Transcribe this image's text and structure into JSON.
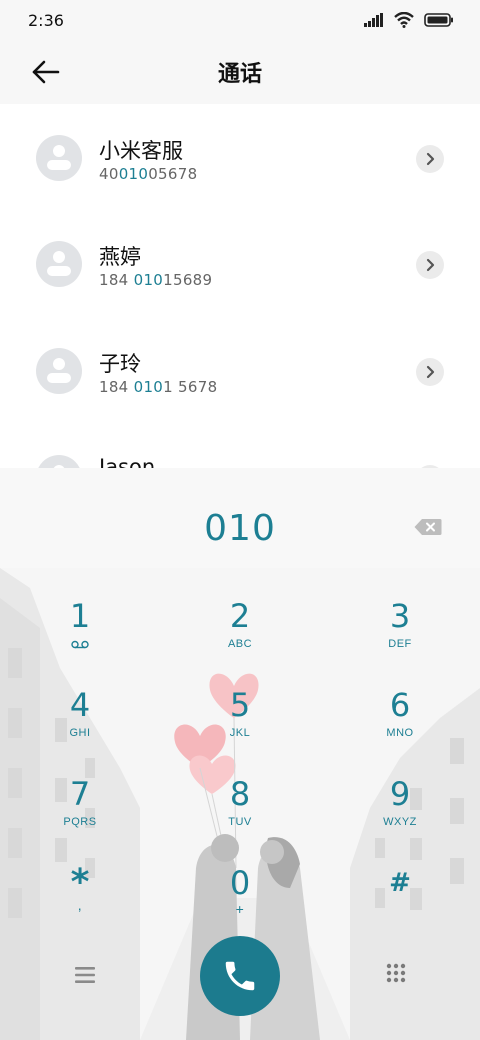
{
  "status": {
    "time": "2:36"
  },
  "header": {
    "title": "通话"
  },
  "contacts": [
    {
      "name": "小米客服",
      "number_parts": [
        "40",
        "010",
        "05678"
      ]
    },
    {
      "name": "燕婷",
      "number_parts": [
        "184 ",
        "010",
        "15689"
      ]
    },
    {
      "name": "子玲",
      "number_parts": [
        "184 ",
        "010",
        "1 5678"
      ]
    },
    {
      "name": "Jason",
      "number_parts": [
        "",
        "",
        ""
      ]
    }
  ],
  "dialer": {
    "input": "010",
    "keys": [
      {
        "digit": "1",
        "letters": ""
      },
      {
        "digit": "2",
        "letters": "ABC"
      },
      {
        "digit": "3",
        "letters": "DEF"
      },
      {
        "digit": "4",
        "letters": "GHI"
      },
      {
        "digit": "5",
        "letters": "JKL"
      },
      {
        "digit": "6",
        "letters": "MNO"
      },
      {
        "digit": "7",
        "letters": "PQRS"
      },
      {
        "digit": "8",
        "letters": "TUV"
      },
      {
        "digit": "9",
        "letters": "WXYZ"
      },
      {
        "digit": "*",
        "letters": ","
      },
      {
        "digit": "0",
        "letters": "+"
      },
      {
        "digit": "#",
        "letters": ""
      }
    ]
  },
  "colors": {
    "accent": "#1d7f93",
    "call_button": "#1c7b8e"
  },
  "icons": [
    "back-arrow-icon",
    "signal-icon",
    "wifi-icon",
    "battery-icon",
    "chevron-right-icon",
    "backspace-icon",
    "voicemail-icon",
    "menu-icon",
    "phone-icon",
    "keypad-icon"
  ]
}
